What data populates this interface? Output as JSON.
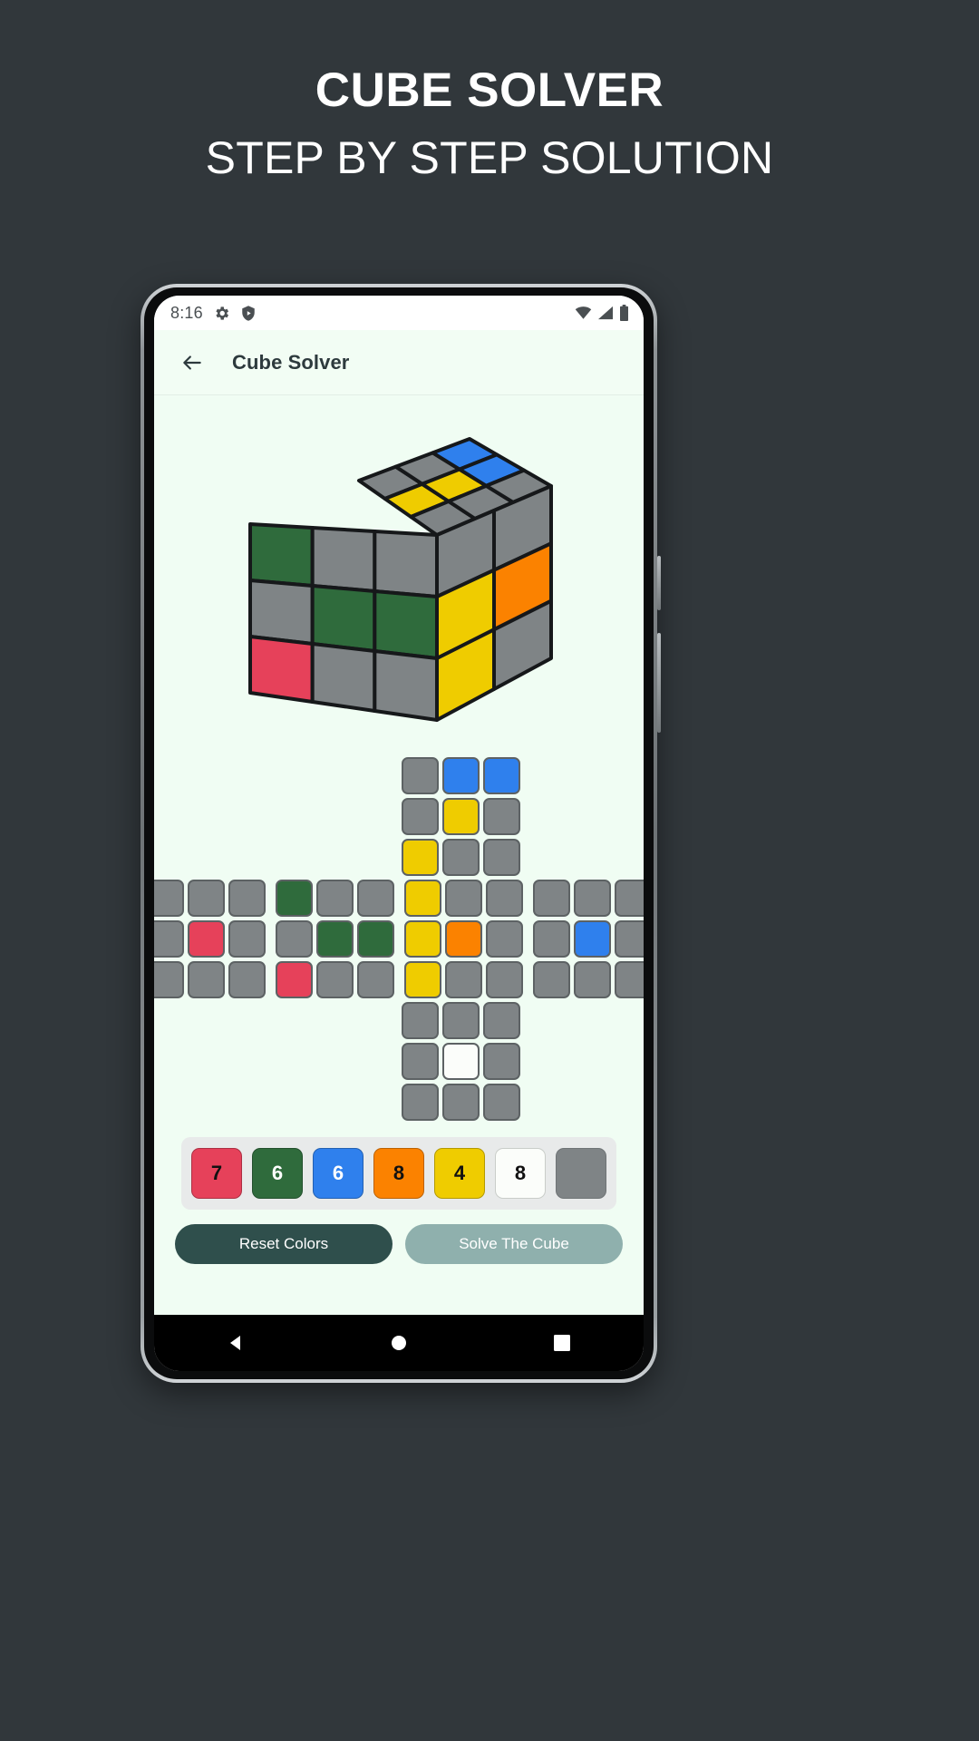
{
  "promo": {
    "title": "CUBE SOLVER",
    "subtitle": "STEP BY STEP SOLUTION",
    "background_color": "#31373b",
    "text_color": "#ffffff"
  },
  "statusbar": {
    "time": "8:16",
    "left_icons": [
      "gear-icon",
      "shield-play-icon"
    ],
    "right_icons": [
      "wifi-icon",
      "signal-icon",
      "battery-icon"
    ]
  },
  "appbar": {
    "title": "Cube Solver",
    "back_icon": "arrow-left-icon",
    "background_color": "#f2fdf4",
    "title_color": "#2d3a3d"
  },
  "colors": {
    "red": "#e6415a",
    "green": "#2f6b3c",
    "blue": "#2f80ed",
    "orange": "#fb8200",
    "yellow": "#efcc00",
    "white": "#fbfdfa",
    "gray": "#7f8486",
    "cube_gray": "#464a4d",
    "stroke": "#5d6264",
    "app_bg": "#f0fdf3"
  },
  "cube3d": {
    "top_face": [
      [
        "gray",
        "gray",
        "blue"
      ],
      [
        "yellow",
        "yellow",
        "blue"
      ],
      [
        "gray",
        "gray",
        "gray"
      ]
    ],
    "front_face": [
      [
        "green",
        "gray",
        "gray"
      ],
      [
        "gray",
        "green",
        "green"
      ],
      [
        "red",
        "gray",
        "gray"
      ]
    ],
    "right_face": [
      [
        "gray",
        "gray"
      ],
      [
        "yellow",
        "orange"
      ],
      [
        "yellow",
        "gray"
      ]
    ]
  },
  "net": {
    "top": [
      [
        "gray",
        "blue",
        "blue"
      ],
      [
        "gray",
        "yellow",
        "gray"
      ],
      [
        "yellow",
        "gray",
        "gray"
      ]
    ],
    "left": [
      [
        "gray",
        "gray",
        "gray"
      ],
      [
        "gray",
        "red",
        "gray"
      ],
      [
        "gray",
        "gray",
        "gray"
      ]
    ],
    "front": [
      [
        "green",
        "gray",
        "gray"
      ],
      [
        "gray",
        "green",
        "green"
      ],
      [
        "red",
        "gray",
        "gray"
      ]
    ],
    "right": [
      [
        "yellow",
        "gray",
        "gray"
      ],
      [
        "yellow",
        "orange",
        "gray"
      ],
      [
        "yellow",
        "gray",
        "gray"
      ]
    ],
    "back": [
      [
        "gray",
        "gray",
        "gray"
      ],
      [
        "gray",
        "blue",
        "gray"
      ],
      [
        "gray",
        "gray",
        "gray"
      ]
    ],
    "bottom": [
      [
        "gray",
        "gray",
        "gray"
      ],
      [
        "gray",
        "white",
        "gray"
      ],
      [
        "gray",
        "gray",
        "gray"
      ]
    ]
  },
  "palette": [
    {
      "name": "red",
      "color": "#e6415a",
      "count": "7"
    },
    {
      "name": "green",
      "color": "#2f6b3c",
      "count": "6"
    },
    {
      "name": "blue",
      "color": "#2f80ed",
      "count": "6"
    },
    {
      "name": "orange",
      "color": "#fb8200",
      "count": "8"
    },
    {
      "name": "yellow",
      "color": "#efcc00",
      "count": "4"
    },
    {
      "name": "white",
      "color": "#fbfdfa",
      "count": "8"
    },
    {
      "name": "gray",
      "color": "#7f8486",
      "count": ""
    }
  ],
  "actions": {
    "reset_label": "Reset Colors",
    "reset_color": "#2f4f4c",
    "solve_label": "Solve The Cube",
    "solve_color": "#8fb0ad"
  },
  "navbar": {
    "back": "nav-back-triangle",
    "home": "nav-home-circle",
    "recents": "nav-recents-square"
  }
}
